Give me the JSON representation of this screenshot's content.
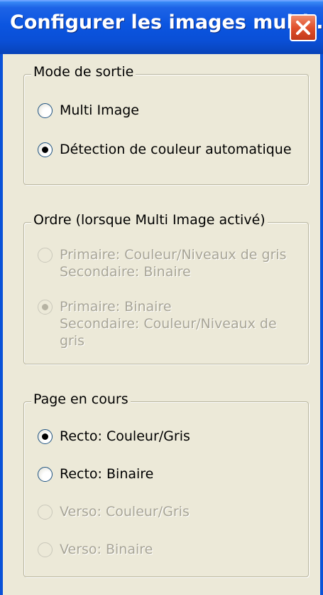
{
  "window": {
    "title": "Configurer les images multi..."
  },
  "groups": {
    "output_mode": {
      "legend": "Mode de sortie",
      "options": [
        {
          "label": "Multi Image",
          "selected": false,
          "enabled": true
        },
        {
          "label": "Détection de couleur automatique",
          "selected": true,
          "enabled": true
        }
      ]
    },
    "order": {
      "legend": "Ordre (lorsque Multi Image activé)",
      "options": [
        {
          "line1": "Primaire: Couleur/Niveaux de gris",
          "line2": "Secondaire: Binaire",
          "selected": false,
          "enabled": false
        },
        {
          "line1": "Primaire: Binaire",
          "line2": "Secondaire: Couleur/Niveaux de",
          "line3": "gris",
          "selected": true,
          "enabled": false
        }
      ]
    },
    "current_page": {
      "legend": "Page en cours",
      "options": [
        {
          "label": "Recto: Couleur/Gris",
          "selected": true,
          "enabled": true
        },
        {
          "label": "Recto: Binaire",
          "selected": false,
          "enabled": true
        },
        {
          "label": "Verso: Couleur/Gris",
          "selected": false,
          "enabled": false
        },
        {
          "label": "Verso: Binaire",
          "selected": false,
          "enabled": false
        }
      ]
    }
  },
  "colors": {
    "titlebar": "#0a4fd6",
    "close_button": "#e0502c",
    "dialog_background": "#ece9d8",
    "disabled_text": "#a8a597"
  },
  "icons": {
    "close": "close-icon",
    "radio": "radio-button"
  }
}
